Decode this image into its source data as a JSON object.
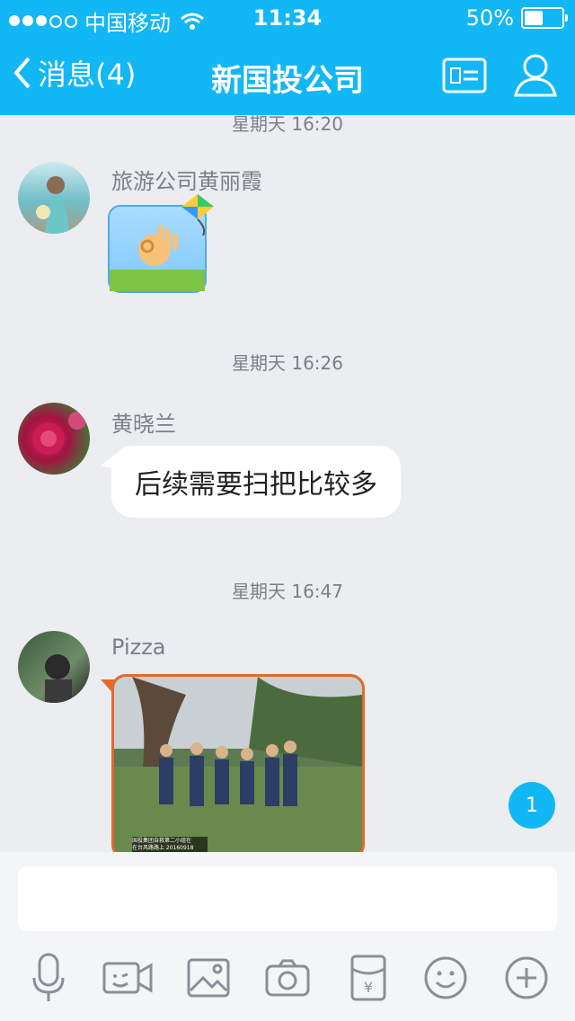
{
  "status_bar": {
    "carrier": "中国移动",
    "time": "11:34",
    "battery": "50%",
    "battery_level": 0.5
  },
  "nav": {
    "back_label": "消息(4)",
    "title": "新国投公司"
  },
  "messages": [
    {
      "time": "星期天 16:20",
      "sender": "旅游公司黄丽霞",
      "type": "sticker",
      "sticker": "ok-hand-sticker"
    },
    {
      "time": "星期天 16:26",
      "sender": "黄晓兰",
      "type": "text",
      "text": "后续需要扫把比较多"
    },
    {
      "time": "星期天 16:47",
      "sender": "Pizza",
      "type": "image",
      "caption": "国投集团自救第二小组在 \n 在台风路路上 20160918"
    }
  ],
  "unread_badge": "1",
  "input": {
    "placeholder": ""
  },
  "toolbar_icons": [
    "microphone-icon",
    "video-icon",
    "image-icon",
    "camera-icon",
    "red-packet-icon",
    "emoji-icon",
    "plus-icon"
  ],
  "colors": {
    "primary": "#12b7f5",
    "background": "#ebedf1",
    "bubble": "#ffffff",
    "photo_border": "#e36a2b"
  }
}
